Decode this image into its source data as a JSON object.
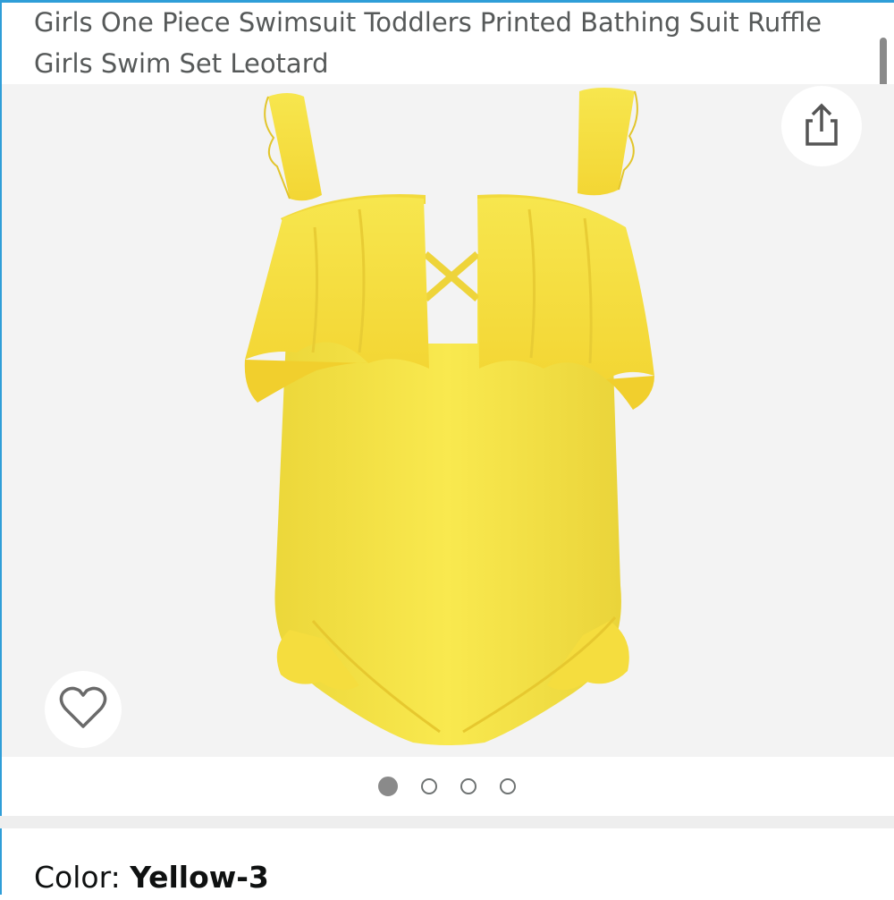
{
  "product": {
    "title": "Girls One Piece Swimsuit Toddlers Printed Bathing Suit Ruffle Girls Swim Set Leotard",
    "color_label": "Color:",
    "color_value": "Yellow-3"
  },
  "gallery": {
    "image_count": 4,
    "active_index": 0,
    "image_subject": "yellow ruffle one-piece swimsuit",
    "image_color": "#f7e44a"
  },
  "icons": {
    "share": "share-icon",
    "wishlist": "heart-icon"
  },
  "colors": {
    "accent": "#2f9ed8",
    "title_text": "#565959",
    "gallery_bg": "#f3f3f3"
  }
}
